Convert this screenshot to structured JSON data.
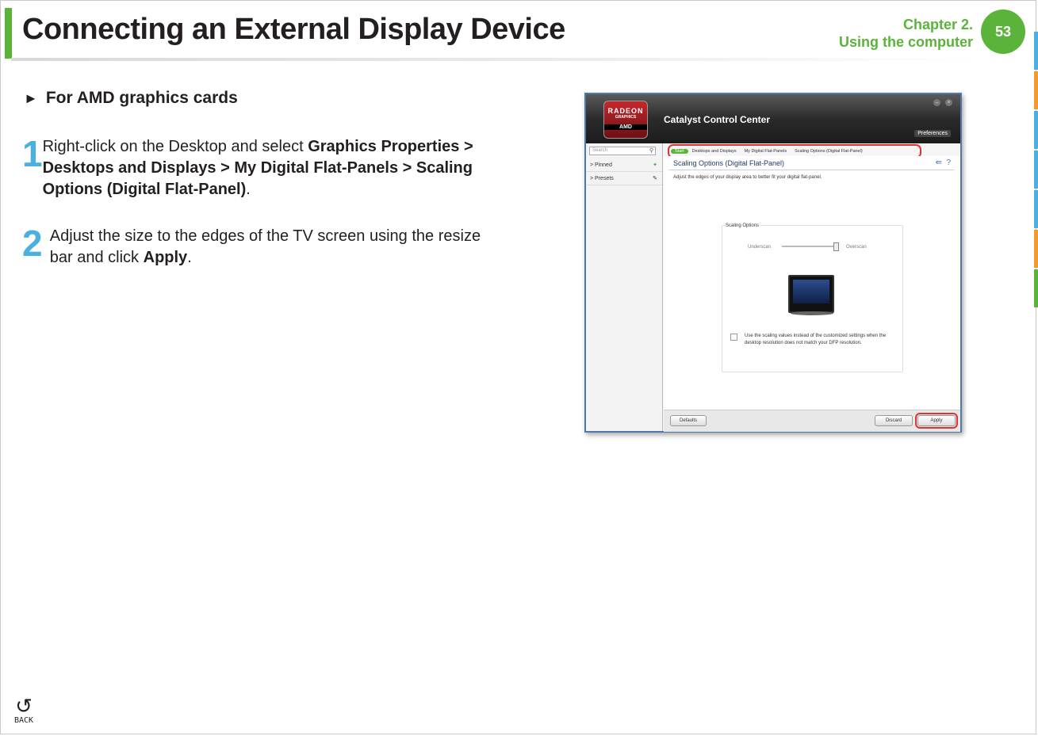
{
  "header": {
    "title": "Connecting an External Display Device",
    "chapter": "Chapter 2.",
    "chapter_subtitle": "Using the computer",
    "page_number": "53"
  },
  "section": {
    "heading": "For AMD graphics cards"
  },
  "steps": [
    {
      "number": "1",
      "text_plain": "Right-click on the Desktop and select ",
      "text_bold": "Graphics Properties > Desktops and Displays > My Digital Flat-Panels > Scaling Options (Digital Flat-Panel)",
      "text_end": "."
    },
    {
      "number": "2",
      "text_plain": "Adjust the size to the edges of the TV screen using the resize bar and click ",
      "text_bold": "Apply",
      "text_end": "."
    }
  ],
  "back": {
    "label": "BACK"
  },
  "screenshot": {
    "logo_line1": "RADEON",
    "logo_line2": "GRAPHICS",
    "logo_line3": "AMD",
    "app_title": "Catalyst Control Center",
    "preferences": "Preferences",
    "search_placeholder": "Search",
    "sidebar": [
      "Pinned",
      "Presets"
    ],
    "breadcrumbs": [
      "Start",
      "Desktops and Displays",
      "My Digital Flat-Panels",
      "Scaling Options (Digital Flat-Panel)"
    ],
    "page_title": "Scaling Options (Digital Flat-Panel)",
    "description": "Adjust the edges of your display area to better fit your digital flat-panel.",
    "group_label": "Scaling Options",
    "underscan": "Underscan",
    "overscan": "Overscan",
    "checkbox_text": "Use the scaling values instead of the customized settings when the desktop resolution does not match your DFP resolution.",
    "defaults_button": "Defaults",
    "discard_button": "Discard",
    "apply_button": "Apply"
  },
  "colors": {
    "accent_green": "#5bb43a",
    "step_blue": "#4ab0e0",
    "highlight_red": "#dd3333"
  }
}
